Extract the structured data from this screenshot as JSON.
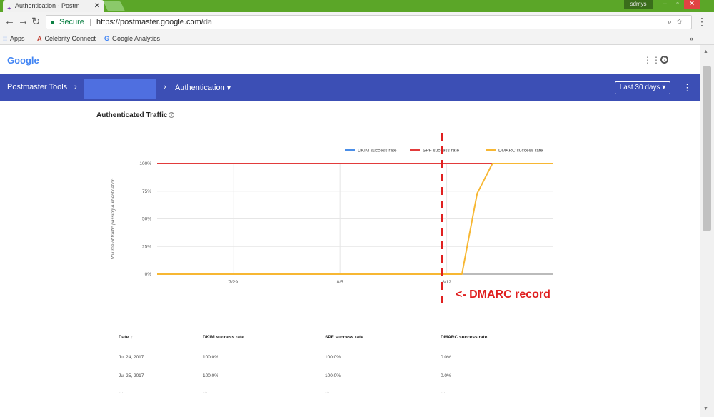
{
  "browser": {
    "tab_title": "Authentication - Postm",
    "user_badge": "sdmys",
    "secure_label": "Secure",
    "url_host": "https://postmaster.google.com/",
    "url_path": "da",
    "bookmarks": [
      {
        "icon": "apps-icon",
        "label": "Apps"
      },
      {
        "icon": "celebrity-connect-icon",
        "label": "Celebrity Connect"
      },
      {
        "icon": "google-g-icon",
        "label": "Google Analytics"
      }
    ]
  },
  "header": {
    "logo": "Google"
  },
  "postmaster_bar": {
    "title": "Postmaster Tools",
    "section": "Authentication",
    "date_range": "Last 30 days"
  },
  "page": {
    "section_title": "Authenticated Traffic"
  },
  "chart_data": {
    "type": "line",
    "x": [
      "Jul 24",
      "Jul 25",
      "Jul 26",
      "Jul 27",
      "Jul 28",
      "Jul 29",
      "Jul 30",
      "Jul 31",
      "Aug 1",
      "Aug 2",
      "Aug 3",
      "Aug 4",
      "Aug 5",
      "Aug 6",
      "Aug 7",
      "Aug 8",
      "Aug 9",
      "Aug 10",
      "Aug 11",
      "Aug 12",
      "Aug 13",
      "Aug 14",
      "Aug 15",
      "Aug 16",
      "Aug 17",
      "Aug 18",
      "Aug 19"
    ],
    "xticks": [
      {
        "label": "7/29",
        "index": 5
      },
      {
        "label": "8/5",
        "index": 12
      },
      {
        "label": "8/12",
        "index": 19
      }
    ],
    "yticks": [
      "0%",
      "25%",
      "50%",
      "75%",
      "100%"
    ],
    "ylabel": "Volume of traffic passing Authentication",
    "ylim": [
      0,
      100
    ],
    "legend_position": "top-right",
    "series": [
      {
        "name": "DKIM success rate",
        "color": "#4a8ee8",
        "values": [
          100,
          100,
          100,
          100,
          100,
          100,
          100,
          100,
          100,
          100,
          100,
          100,
          100,
          100,
          100,
          100,
          100,
          100,
          100,
          100,
          100,
          100,
          100,
          100,
          100,
          100,
          100
        ]
      },
      {
        "name": "SPF success rate",
        "color": "#e23b3b",
        "values": [
          100,
          100,
          100,
          100,
          100,
          100,
          100,
          100,
          100,
          100,
          100,
          100,
          100,
          100,
          100,
          100,
          100,
          100,
          100,
          100,
          100,
          100,
          100,
          100,
          100,
          100,
          100
        ]
      },
      {
        "name": "DMARC success rate",
        "color": "#f7b733",
        "values": [
          0,
          0,
          0,
          0,
          0,
          0,
          0,
          0,
          0,
          0,
          0,
          0,
          0,
          0,
          0,
          0,
          0,
          0,
          0,
          0,
          0,
          73,
          100,
          100,
          100,
          100,
          100
        ]
      }
    ],
    "annotation": {
      "label": "<- DMARC record",
      "color": "#e02020",
      "x_index": 20
    }
  },
  "table": {
    "headers": [
      "Date",
      "DKIM success rate",
      "SPF success rate",
      "DMARC success rate"
    ],
    "rows": [
      [
        "Jul 24, 2017",
        "100.0%",
        "100.0%",
        "0.0%"
      ],
      [
        "Jul 25, 2017",
        "100.0%",
        "100.0%",
        "0.0%"
      ]
    ]
  }
}
